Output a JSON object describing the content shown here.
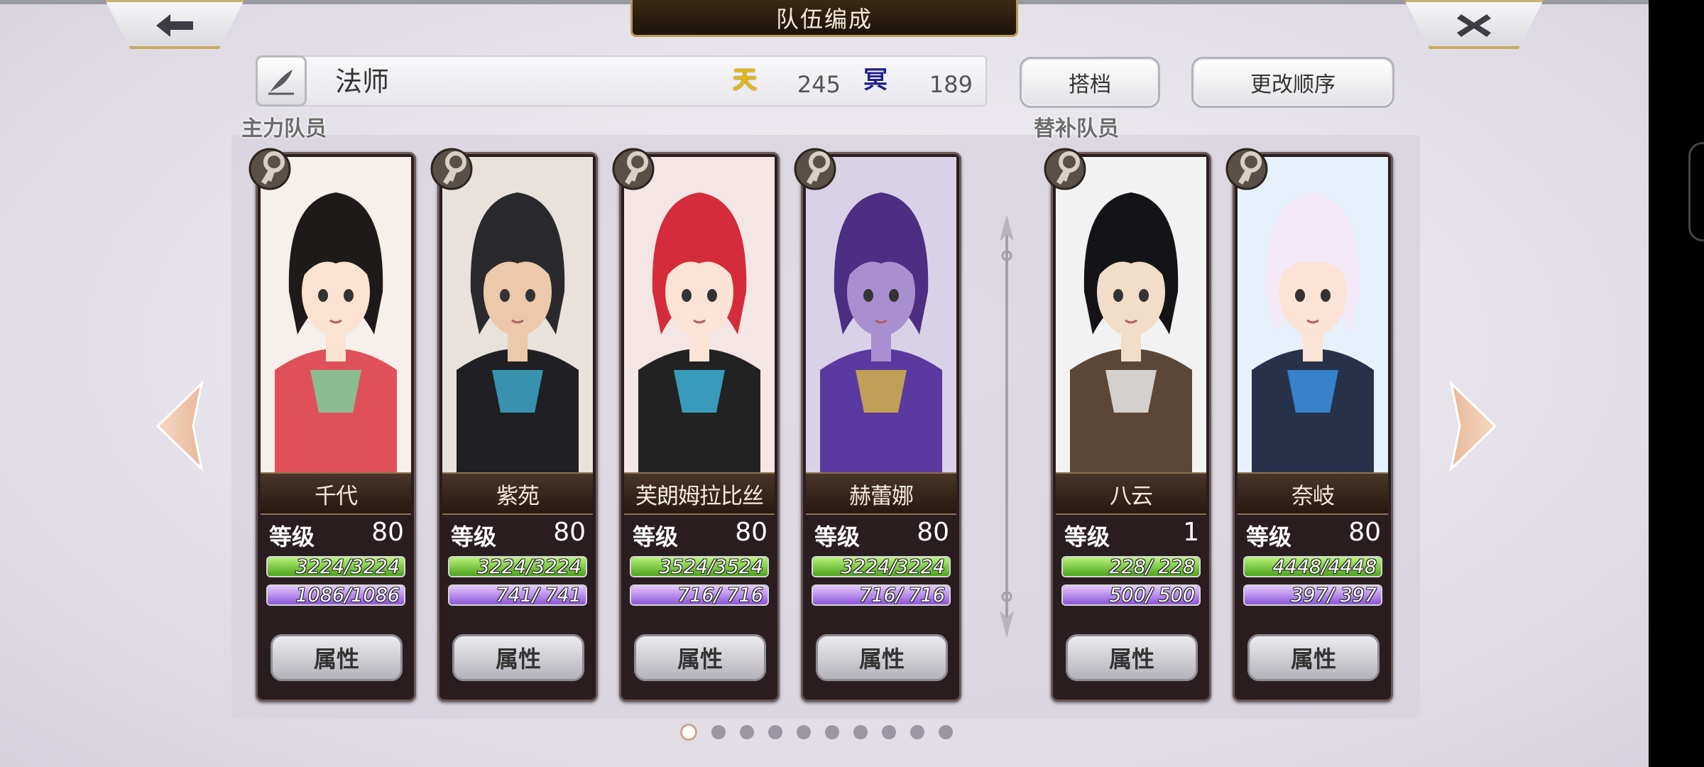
{
  "header": {
    "title": "队伍编成",
    "back_icon": "back-arrow-icon",
    "close_icon": "close-x-icon"
  },
  "team": {
    "name": "法师",
    "stat_sky_icon_text": "天",
    "stat_sky_value": "245",
    "stat_dark_icon_text": "冥",
    "stat_dark_value": "189"
  },
  "buttons": {
    "partner": "搭档",
    "reorder": "更改顺序",
    "attribute": "属性"
  },
  "sections": {
    "main_members": "主力队员",
    "sub_members": "替补队员"
  },
  "members": [
    {
      "name": "千代",
      "level_label": "等级",
      "level": "80",
      "hp": "3224/3224",
      "mp": "1086/1086",
      "hp_ratio": 1,
      "mp_ratio": 1
    },
    {
      "name": "紫苑",
      "level_label": "等级",
      "level": "80",
      "hp": "3224/3224",
      "mp": "741/ 741",
      "hp_ratio": 1,
      "mp_ratio": 1
    },
    {
      "name": "芙朗姆拉比丝",
      "level_label": "等级",
      "level": "80",
      "hp": "3524/3524",
      "mp": "716/ 716",
      "hp_ratio": 1,
      "mp_ratio": 1
    },
    {
      "name": "赫蕾娜",
      "level_label": "等级",
      "level": "80",
      "hp": "3224/3224",
      "mp": "716/ 716",
      "hp_ratio": 1,
      "mp_ratio": 1
    },
    {
      "name": "八云",
      "level_label": "等级",
      "level": "1",
      "hp": "228/ 228",
      "mp": "500/ 500",
      "hp_ratio": 1,
      "mp_ratio": 1
    },
    {
      "name": "奈岐",
      "level_label": "等级",
      "level": "80",
      "hp": "4448/4448",
      "mp": "397/ 397",
      "hp_ratio": 1,
      "mp_ratio": 1
    }
  ],
  "pagination": {
    "total": 10,
    "current": 1
  },
  "colors": {
    "hp_bar": "#6cc22a",
    "mp_bar": "#a672e6",
    "accent_gold": "#c7ad5e"
  }
}
